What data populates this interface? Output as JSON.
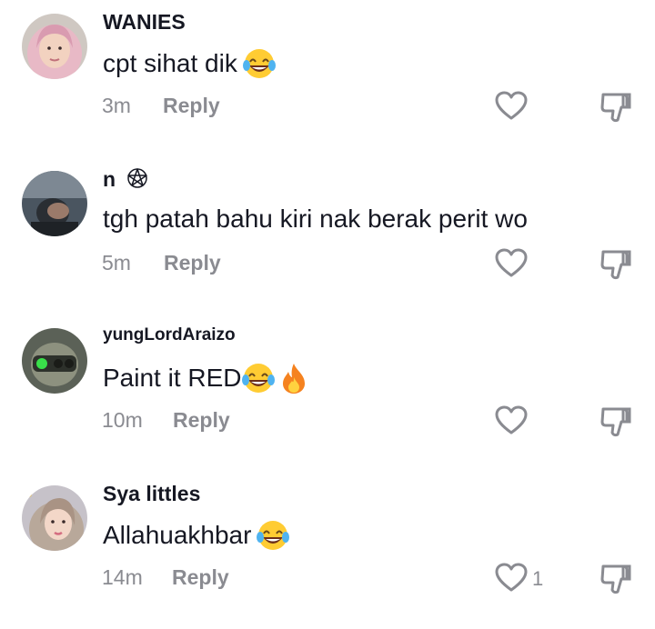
{
  "comments": [
    {
      "username": "WANIES",
      "text": "cpt sihat dik",
      "emoji": [
        "laughing-crying"
      ],
      "time": "3m",
      "reply_label": "Reply",
      "like_count": ""
    },
    {
      "username": "n",
      "username_icon": "pentagram",
      "text": "tgh patah bahu kiri nak berak perit wo",
      "emoji": [],
      "time": "5m",
      "reply_label": "Reply",
      "like_count": ""
    },
    {
      "username": "yungLordAraizo",
      "text": "Paint it RED",
      "emoji": [
        "laughing-crying",
        "fire"
      ],
      "time": "10m",
      "reply_label": "Reply",
      "like_count": ""
    },
    {
      "username": "Sya littles",
      "text": "Allahuakhbar",
      "emoji": [
        "laughing-crying"
      ],
      "time": "14m",
      "reply_label": "Reply",
      "like_count": "1"
    }
  ],
  "colors": {
    "text": "#161823",
    "muted": "#8a8b91",
    "background": "#ffffff"
  },
  "icons": {
    "like": "heart-outline-icon",
    "dislike": "thumbs-down-outline-icon"
  }
}
